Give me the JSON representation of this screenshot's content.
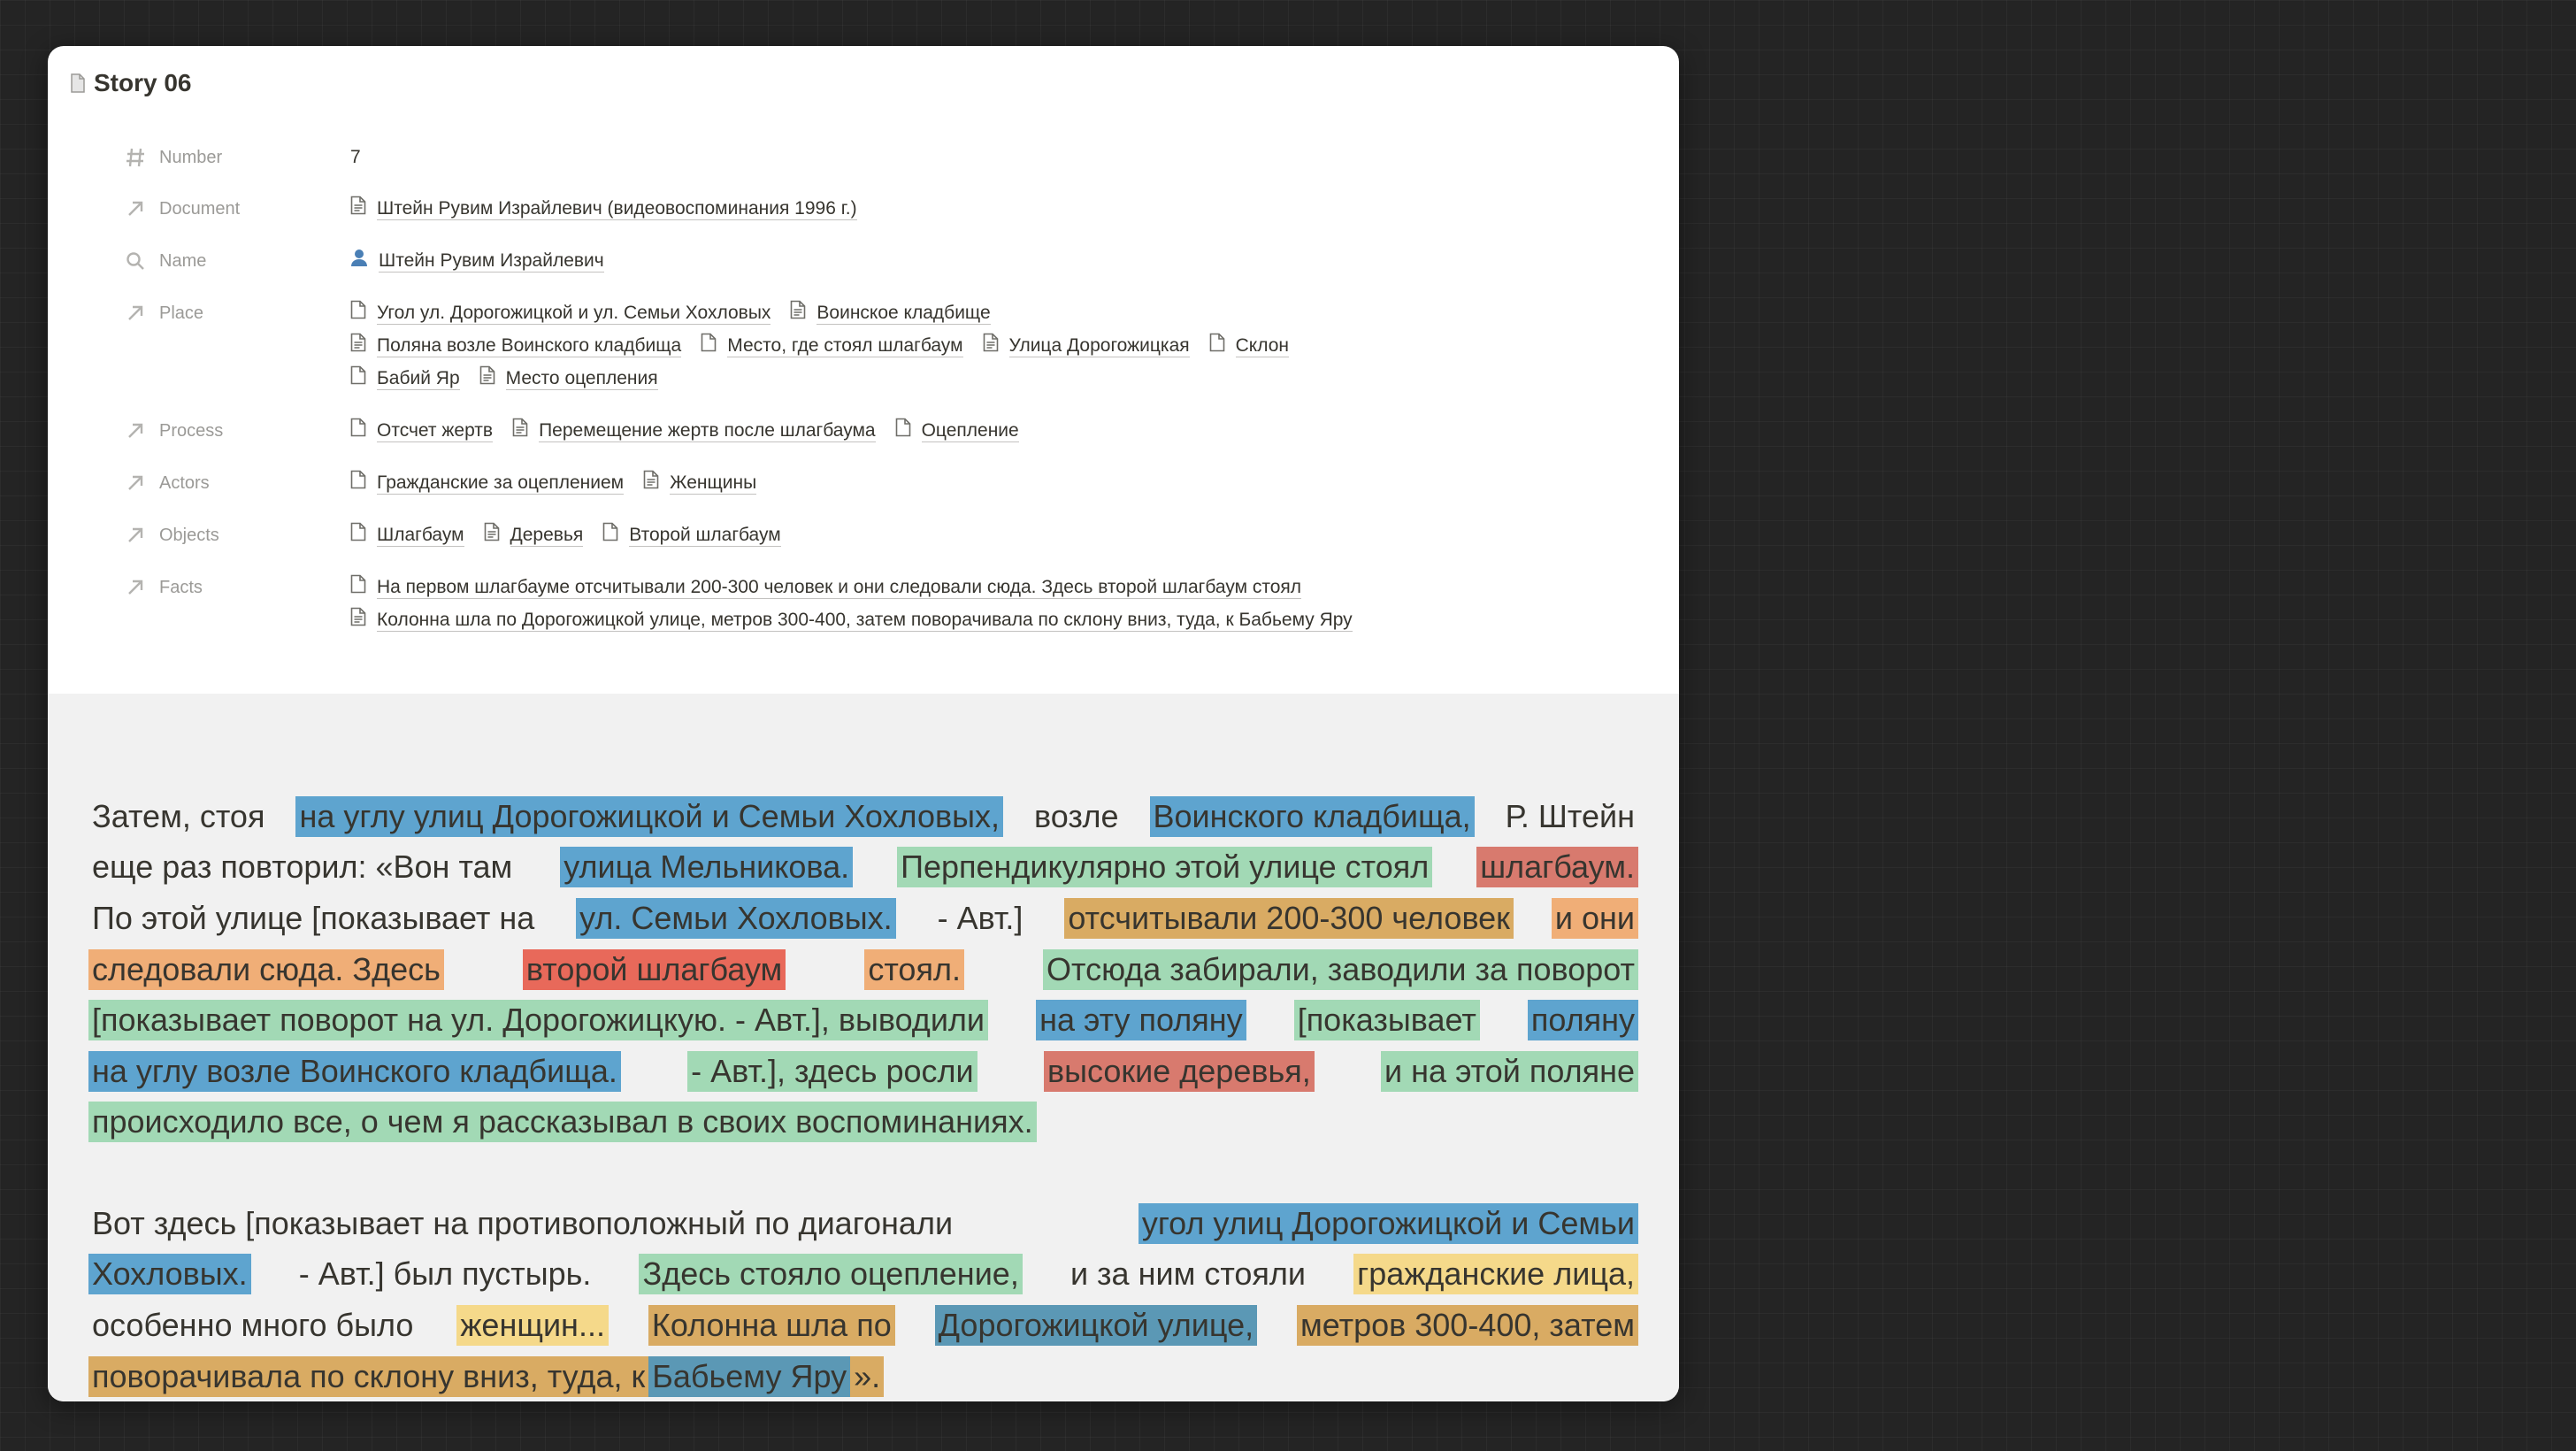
{
  "page": {
    "title": "Story 06"
  },
  "properties": {
    "number": {
      "label": "Number",
      "value": "7"
    },
    "document": {
      "label": "Document",
      "items": [
        "Штейн Рувим Израйлевич (видеовоспоминания 1996 г.)"
      ]
    },
    "name": {
      "label": "Name",
      "items": [
        "Штейн Рувим Израйлевич"
      ]
    },
    "place": {
      "label": "Place",
      "lines": [
        [
          "Угол ул. Дорогожицкой и ул. Семьи Хохловых",
          "Воинское кладбище"
        ],
        [
          "Поляна возле Воинского кладбища",
          "Место, где стоял шлагбаум",
          "Улица Дорогожицкая",
          "Склон"
        ],
        [
          "Бабий Яр",
          "Место оцепления"
        ]
      ]
    },
    "process": {
      "label": "Process",
      "lines": [
        [
          "Отсчет жертв",
          "Перемещение жертв после шлагбаума",
          "Оцепление"
        ]
      ]
    },
    "actors": {
      "label": "Actors",
      "lines": [
        [
          "Гражданские за оцеплением",
          "Женщины"
        ]
      ]
    },
    "objects": {
      "label": "Objects",
      "lines": [
        [
          "Шлагбаум",
          "Деревья",
          "Второй шлагбаум"
        ]
      ]
    },
    "facts": {
      "label": "Facts",
      "lines": [
        [
          "На первом шлагбауме отсчитывали 200-300 человек и они следовали сюда. Здесь второй шлагбаум стоял"
        ],
        [
          "Колонна шла по Дорогожицкой улице, метров 300-400, затем поворачивала по склону вниз, туда, к Бабьему Яру"
        ]
      ]
    }
  },
  "colors": {
    "blue": "#5ea4cf",
    "steel": "#5b98b5",
    "green": "#a2d9b5",
    "red": "#d87a6e",
    "red_bright": "#e8695a",
    "orange": "#f0ae77",
    "tan": "#d9ab63",
    "yellow": "#f5d98a"
  },
  "paragraphs": [
    {
      "lines": [
        {
          "segs": [
            {
              "t": "Затем, стоя"
            },
            {
              "t": "на углу улиц Дорогожицкой и Семьи Хохловых,",
              "c": "blue"
            },
            {
              "t": "возле"
            },
            {
              "t": "Воинского кладбища,",
              "c": "blue"
            },
            {
              "t": "Р. Штейн"
            }
          ]
        },
        {
          "segs": [
            {
              "t": "еще раз повторил: «Вон там"
            },
            {
              "t": "улица Мельникова.",
              "c": "blue"
            },
            {
              "t": "Перпендикулярно этой улице стоял",
              "c": "green"
            },
            {
              "t": "шлагбаум.",
              "c": "red"
            }
          ]
        },
        {
          "segs": [
            {
              "t": "По этой улице [показывает на"
            },
            {
              "t": "ул. Семьи Хохловых.",
              "c": "blue"
            },
            {
              "t": "- Авт.]"
            },
            {
              "t": "отсчитывали 200-300 человек",
              "c": "tan"
            },
            {
              "t": "и они",
              "c": "orange"
            }
          ]
        },
        {
          "segs": [
            {
              "t": "следовали сюда. Здесь",
              "c": "orange"
            },
            {
              "t": "второй шлагбаум",
              "c": "red_bright"
            },
            {
              "t": "стоял.",
              "c": "orange"
            },
            {
              "t": "Отсюда забирали, заводили за поворот",
              "c": "green"
            }
          ]
        },
        {
          "segs": [
            {
              "t": "[показывает поворот на ул. Дорогожицкую. - Авт.], выводили",
              "c": "green"
            },
            {
              "t": "на эту поляну",
              "c": "blue"
            },
            {
              "t": "[показывает",
              "c": "green"
            },
            {
              "t": "поляну",
              "c": "blue"
            }
          ]
        },
        {
          "segs": [
            {
              "t": "на углу возле Воинского кладбища.",
              "c": "blue"
            },
            {
              "t": "- Авт.], здесь росли",
              "c": "green"
            },
            {
              "t": "высокие деревья,",
              "c": "red"
            },
            {
              "t": "и на этой поляне",
              "c": "green"
            }
          ]
        },
        {
          "last": true,
          "segs": [
            {
              "t": "происходило все, о чем я рассказывал в своих воспоминаниях.",
              "c": "green"
            }
          ]
        }
      ]
    },
    {
      "lines": [
        {
          "segs": [
            {
              "t": "Вот здесь [показывает на противоположный по диагонали"
            },
            {
              "t": "угол улиц Дорогожицкой и Семьи",
              "c": "blue"
            }
          ]
        },
        {
          "segs": [
            {
              "t": "Хохловых.",
              "c": "blue"
            },
            {
              "t": "- Авт.] был пустырь."
            },
            {
              "t": "Здесь стояло оцепление,",
              "c": "green"
            },
            {
              "t": "и за ним стояли"
            },
            {
              "t": "гражданские лица,",
              "c": "yellow"
            }
          ]
        },
        {
          "segs": [
            {
              "t": "особенно много было"
            },
            {
              "t": "женщин...",
              "c": "yellow"
            },
            {
              "t": "Колонна шла по",
              "c": "tan"
            },
            {
              "t": "Дорогожицкой улице,",
              "c": "steel"
            },
            {
              "t": "метров 300-400, затем",
              "c": "tan"
            }
          ]
        },
        {
          "last": true,
          "segs": [
            {
              "t": "поворачивала по склону вниз, туда, к",
              "c": "tan"
            },
            {
              "t": "Бабьему Яру",
              "c": "steel"
            },
            {
              "t": "».",
              "c": "tan"
            }
          ]
        }
      ]
    }
  ]
}
